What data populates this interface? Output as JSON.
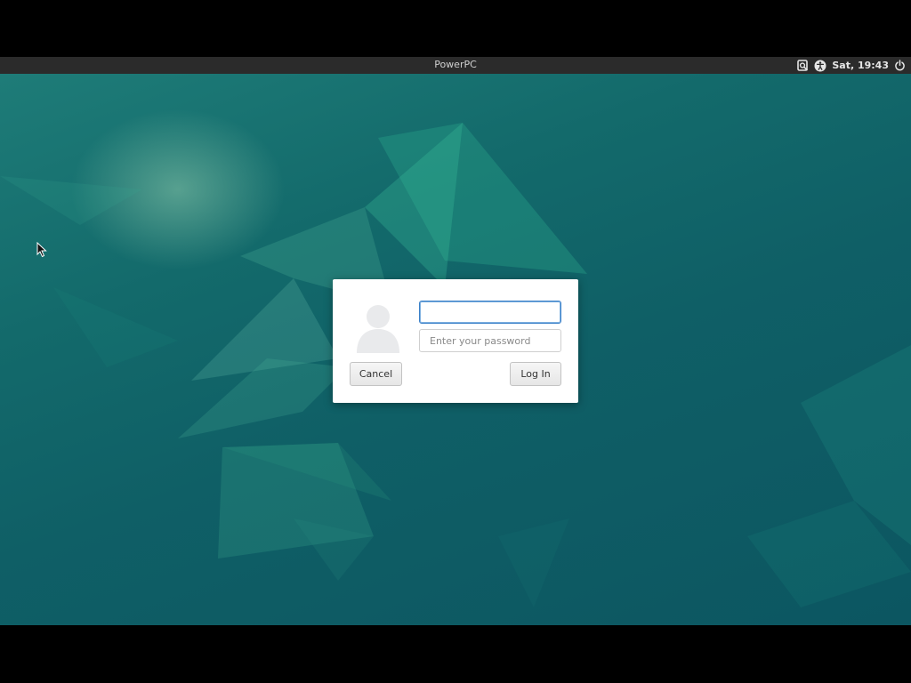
{
  "topbar": {
    "hostname": "PowerPC",
    "clock": "Sat, 19:43",
    "icons": [
      "screenshot-search-icon",
      "accessibility-icon",
      "power-icon"
    ]
  },
  "login_dialog": {
    "username_value": "",
    "password_placeholder": "Enter your password",
    "cancel_label": "Cancel",
    "login_label": "Log In"
  },
  "colors": {
    "topbar_bg": "#2b2b2b",
    "desktop_teal": "#0f5f66",
    "focus_ring": "#3a80c8",
    "dialog_bg": "#ffffff"
  }
}
